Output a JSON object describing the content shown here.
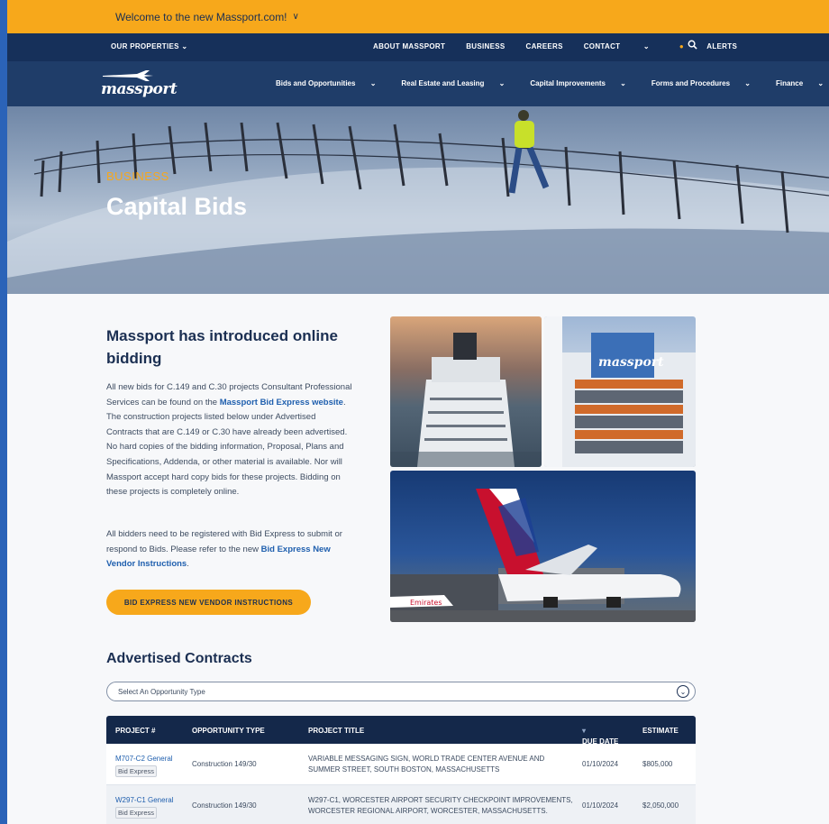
{
  "welcome": {
    "text": "Welcome to the new Massport.com!",
    "chevron": "∨"
  },
  "utility_nav": {
    "our_properties": "OUR PROPERTIES",
    "items": [
      "ABOUT MASSPORT",
      "BUSINESS",
      "CAREERS",
      "CONTACT"
    ],
    "alerts": "ALERTS"
  },
  "logo": {
    "text": "massport"
  },
  "main_nav": {
    "items": [
      "Bids and Opportunities",
      "Real Estate and Leasing",
      "Capital Improvements",
      "Forms and Procedures",
      "Finance"
    ]
  },
  "hero": {
    "eyebrow": "BUSINESS",
    "title": "Capital Bids"
  },
  "intro": {
    "heading": "Massport has introduced online bidding",
    "p1_a": "All new bids for C.149 and C.30 projects Consultant Professional Services can be found on the ",
    "p1_link": "Massport Bid Express website",
    "p1_b": ". The construction projects listed below under Advertised Contracts that are C.149 or C.30 have already been advertised. No hard copies of the bidding information, Proposal, Plans and Specifications, Addenda, or other material is available. Nor will Massport accept hard copy bids for these projects. Bidding on these projects is completely online.",
    "p2_a": "All bidders need to be registered with Bid Express to submit or respond to Bids. Please refer to the new ",
    "p2_link": "Bid Express New Vendor Instructions",
    "p2_b": ".",
    "cta": "BID EXPRESS NEW VENDOR INSTRUCTIONS"
  },
  "contracts": {
    "heading": "Advertised Contracts",
    "select_placeholder": "Select An Opportunity Type",
    "columns": [
      "PROJECT #",
      "OPPORTUNITY TYPE",
      "PROJECT TITLE",
      "DUE DATE",
      "ESTIMATE"
    ],
    "sort_indicator": "▾",
    "rows": [
      {
        "project": "M707-C2 General",
        "badge": "Bid Express",
        "type": "Construction 149/30",
        "title": "VARIABLE MESSAGING SIGN, WORLD TRADE CENTER AVENUE AND SUMMER STREET, SOUTH BOSTON, MASSACHUSETTS",
        "due": "01/10/2024",
        "estimate": "$805,000"
      },
      {
        "project": "W297-C1 General",
        "badge": "Bid Express",
        "type": "Construction 149/30",
        "title": "W297-C1, WORCESTER AIRPORT SECURITY CHECKPOINT IMPROVEMENTS, WORCESTER REGIONAL AIRPORT, WORCESTER, MASSACHUSETTS.",
        "due": "01/10/2024",
        "estimate": "$2,050,000"
      }
    ]
  },
  "photos": {
    "hero_tail_text": "Emirates",
    "building_sign": "massport"
  },
  "colors": {
    "gold": "#f7a81b",
    "navy": "#16305a",
    "navy_dark": "#14284a",
    "link": "#1f5fae"
  }
}
